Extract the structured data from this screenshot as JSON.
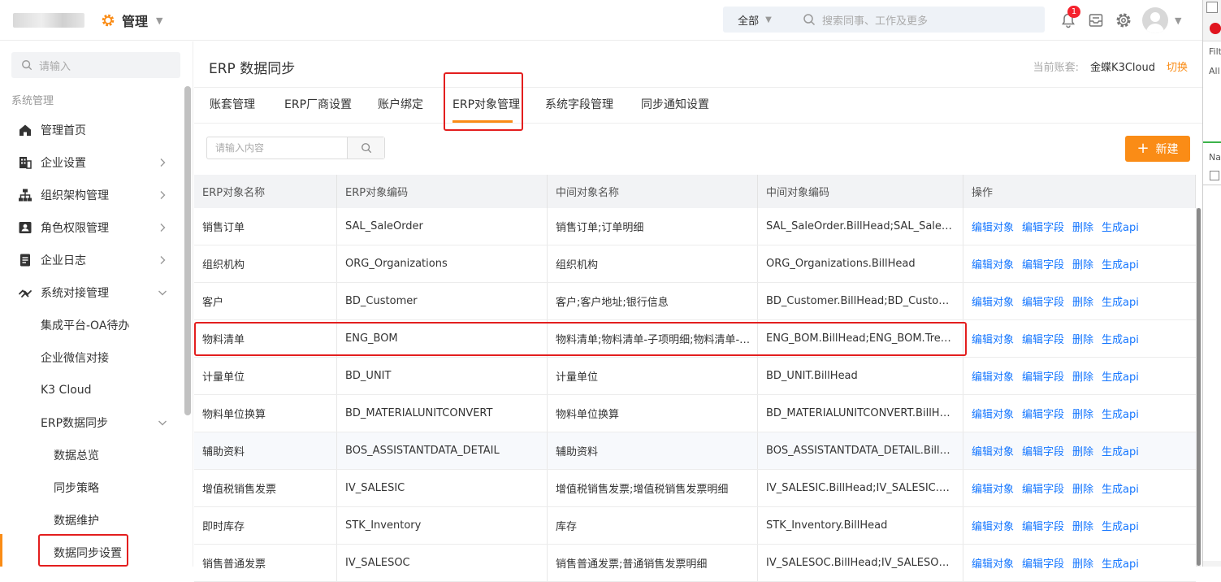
{
  "topbar": {
    "app_title": "管理",
    "search_scope": "全部",
    "search_placeholder": "搜索同事、工作及更多",
    "notification_count": "1"
  },
  "sidebar": {
    "search_placeholder": "请输入",
    "group_label": "系统管理",
    "items": [
      {
        "label": "管理首页",
        "icon": "home-icon"
      },
      {
        "label": "企业设置",
        "icon": "building-icon"
      },
      {
        "label": "组织架构管理",
        "icon": "org-chart-icon"
      },
      {
        "label": "角色权限管理",
        "icon": "id-card-icon"
      },
      {
        "label": "企业日志",
        "icon": "document-icon"
      },
      {
        "label": "系统对接管理",
        "icon": "link-icon"
      }
    ],
    "sub_items": [
      "集成平台-OA待办",
      "企业微信对接",
      "K3 Cloud",
      "ERP数据同步"
    ],
    "sub2_items": [
      "数据总览",
      "同步策略",
      "数据维护",
      "数据同步设置"
    ]
  },
  "main": {
    "title": "ERP 数据同步",
    "account_label": "当前账套:",
    "account_value": "金蝶K3Cloud",
    "switch_label": "切换",
    "tabs": [
      "账套管理",
      "ERP厂商设置",
      "账户绑定",
      "ERP对象管理",
      "系统字段管理",
      "同步通知设置"
    ],
    "active_tab": "ERP对象管理",
    "filter_placeholder": "请输入内容",
    "new_button": "新建"
  },
  "table": {
    "headers": [
      "ERP对象名称",
      "ERP对象编码",
      "中间对象名称",
      "中间对象编码",
      "操作"
    ],
    "actions": [
      "编辑对象",
      "编辑字段",
      "删除",
      "生成api"
    ],
    "rows": [
      [
        "销售订单",
        "SAL_SaleOrder",
        "销售订单;订单明细",
        "SAL_SaleOrder.BillHead;SAL_SaleOrder.SaleOrderEntry"
      ],
      [
        "组织机构",
        "ORG_Organizations",
        "组织机构",
        "ORG_Organizations.BillHead"
      ],
      [
        "客户",
        "BD_Customer",
        "客户;客户地址;银行信息",
        "BD_Customer.BillHead;BD_Customer.FT_BD_CUSTLOCATION"
      ],
      [
        "物料清单",
        "ENG_BOM",
        "物料清单;物料清单-子项明细;物料清单-联副产品",
        "ENG_BOM.BillHead;ENG_BOM.TreeEntity;ENG_BOM.EntryBOMCOBY"
      ],
      [
        "计量单位",
        "BD_UNIT",
        "计量单位",
        "BD_UNIT.BillHead"
      ],
      [
        "物料单位换算",
        "BD_MATERIALUNITCONVERT",
        "物料单位换算",
        "BD_MATERIALUNITCONVERT.BillHead"
      ],
      [
        "辅助资料",
        "BOS_ASSISTANTDATA_DETAIL",
        "辅助资料",
        "BOS_ASSISTANTDATA_DETAIL.BillHead"
      ],
      [
        "增值税销售发票",
        "IV_SALESIC",
        "增值税销售发票;增值税销售发票明细",
        "IV_SALESIC.BillHead;IV_SALESIC.SALESICENTRY"
      ],
      [
        "即时库存",
        "STK_Inventory",
        "库存",
        "STK_Inventory.BillHead"
      ],
      [
        "销售普通发票",
        "IV_SALESOC",
        "销售普通发票;普通销售发票明细",
        "IV_SALESOC.BillHead;IV_SALESOC.SALESICENTRY"
      ]
    ]
  },
  "side_window": {
    "filter_text": "Filt",
    "all_text": "All",
    "name_text": "Nar"
  },
  "colors": {
    "accent": "#fa8c16",
    "link": "#1677ff",
    "highlight_frame": "#e31e1e"
  }
}
